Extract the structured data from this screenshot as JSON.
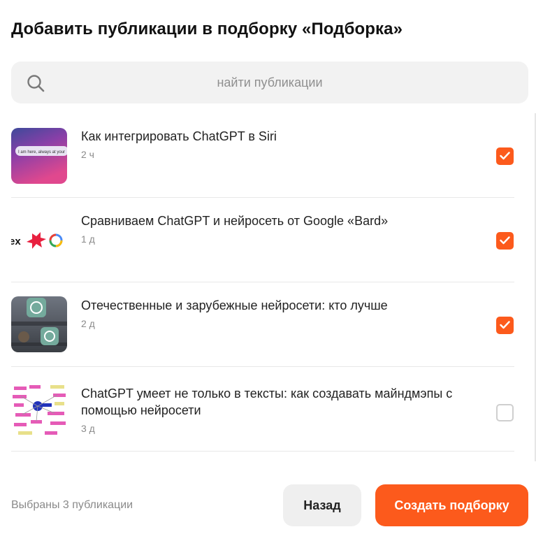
{
  "dialog": {
    "title": "Добавить публикации в подборку «Подборка»"
  },
  "search": {
    "placeholder": "найти публикации",
    "icon": "search-icon"
  },
  "publications": [
    {
      "title": "Как интегрировать ChatGPT в Siri",
      "time": "2 ч",
      "checked": true,
      "thumb_text": "I am here, always at your"
    },
    {
      "title": "Сравниваем ChatGPT и нейросеть от Google «Bard»",
      "time": "1 д",
      "checked": true,
      "thumb_text": "ex"
    },
    {
      "title": "Отечественные и зарубежные нейросети: кто лучше",
      "time": "2 д",
      "checked": true,
      "thumb_text": ""
    },
    {
      "title": "ChatGPT умеет не только в тексты: как создавать майндмэпы с помощью нейросети",
      "time": "3 д",
      "checked": false,
      "thumb_text": ""
    }
  ],
  "footer": {
    "selected_count_text": "Выбраны 3 публикации",
    "back_label": "Назад",
    "create_label": "Создать подборку"
  },
  "colors": {
    "accent": "#fc5a1c",
    "search_bg": "#f2f2f2",
    "secondary_button_bg": "#efefef",
    "muted_text": "#8a8a8a"
  }
}
